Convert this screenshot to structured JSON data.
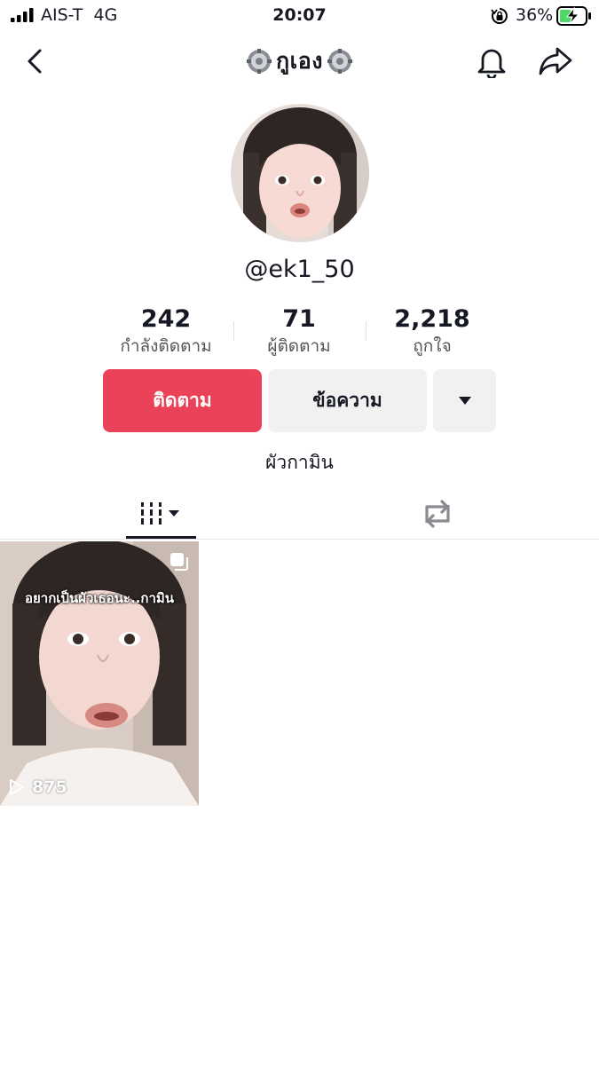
{
  "status_bar": {
    "carrier": "AIS-T",
    "network": "4G",
    "time": "20:07",
    "battery_percent": "36%"
  },
  "header": {
    "title": "กูเอง",
    "title_decoration_icon": "gear-icon",
    "back_icon": "chevron-left-icon",
    "notification_icon": "bell-icon",
    "share_icon": "share-arrow-icon"
  },
  "profile": {
    "username": "@ek1_50",
    "bio": "ผัวกามิน",
    "stats": [
      {
        "value": "242",
        "label": "กำลังติดตาม"
      },
      {
        "value": "71",
        "label": "ผู้ติดตาม"
      },
      {
        "value": "2,218",
        "label": "ถูกใจ"
      }
    ]
  },
  "actions": {
    "follow_label": "ติดตาม",
    "message_label": "ข้อความ",
    "more_icon": "caret-down-icon"
  },
  "tabs": [
    {
      "name": "videos",
      "icon": "grid-lines-icon",
      "selected": true
    },
    {
      "name": "reposts",
      "icon": "repost-icon",
      "selected": false
    }
  ],
  "videos": [
    {
      "caption": "อยากเป็นผัวเธอนะ..กามิน",
      "views": "875"
    }
  ],
  "colors": {
    "follow_button": "#ea4359",
    "secondary_button": "#f1f1f2",
    "text": "#161823"
  }
}
